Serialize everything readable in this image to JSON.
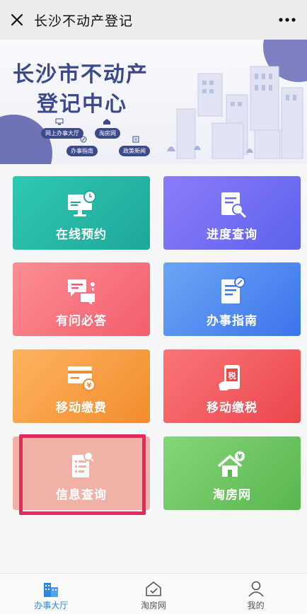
{
  "topbar": {
    "title": "长沙不动产登记",
    "close_icon": "close-icon",
    "more_icon": "more-icon"
  },
  "banner": {
    "title_line1": "长沙市不动产",
    "title_line2": "登记中心",
    "chips": [
      "网上办事大厅",
      "淘房网",
      "办事指南",
      "政策新闻"
    ],
    "colors": {
      "brand": "#3c4a8c",
      "accent": "#7c80c0"
    }
  },
  "tiles": [
    {
      "label": "在线预约",
      "icon": "monitor-clock-icon",
      "color": "#1ea79a"
    },
    {
      "label": "进度查询",
      "icon": "document-search-icon",
      "color": "#5d63ec"
    },
    {
      "label": "有问必答",
      "icon": "chat-bubbles-icon",
      "color": "#f45c6d"
    },
    {
      "label": "办事指南",
      "icon": "guide-document-icon",
      "color": "#3c74ea"
    },
    {
      "label": "移动缴费",
      "icon": "payment-card-icon",
      "color": "#f48b2f"
    },
    {
      "label": "移动缴税",
      "icon": "tax-phone-icon",
      "color": "#e9484c"
    },
    {
      "label": "信息查询",
      "icon": "info-search-icon",
      "color": "#f0b2a7"
    },
    {
      "label": "淘房网",
      "icon": "house-yuan-icon",
      "color": "#58b74c"
    }
  ],
  "bottomnav": {
    "items": [
      {
        "label": "办事大厅",
        "icon": "building-icon",
        "active": true
      },
      {
        "label": "淘房网",
        "icon": "house-check-icon",
        "active": false
      },
      {
        "label": "我的",
        "icon": "user-icon",
        "active": false
      }
    ],
    "active_color": "#2d86e0"
  }
}
